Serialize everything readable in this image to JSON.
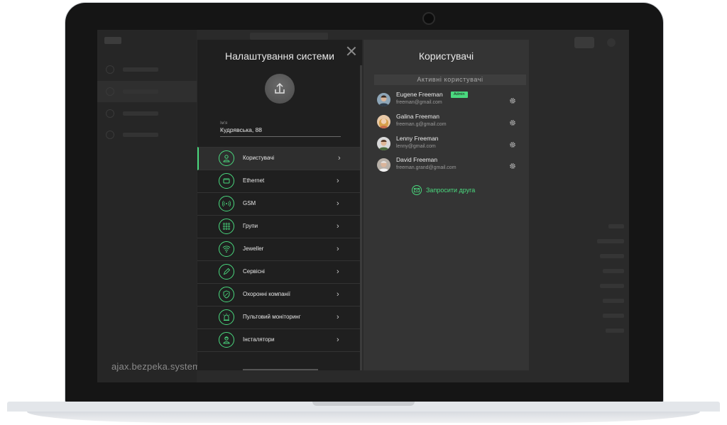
{
  "watermark": "ajax.bezpeka.systems",
  "settings": {
    "title": "Налаштування системи",
    "field_label": "Ім'я",
    "field_value": "Кудрявська, 88",
    "menu": [
      {
        "label": "Користувачі",
        "icon": "user-icon",
        "active": true
      },
      {
        "label": "Ethernet",
        "icon": "ethernet-icon",
        "active": false
      },
      {
        "label": "GSM",
        "icon": "antenna-icon",
        "active": false
      },
      {
        "label": "Групи",
        "icon": "grid-icon",
        "active": false
      },
      {
        "label": "Jeweller",
        "icon": "wifi-icon",
        "active": false
      },
      {
        "label": "Сервісні",
        "icon": "pencil-icon",
        "active": false
      },
      {
        "label": "Охоронні компанії",
        "icon": "shield-icon",
        "active": false
      },
      {
        "label": "Пультовий моніторинг",
        "icon": "siren-icon",
        "active": false
      },
      {
        "label": "Інсталятори",
        "icon": "installer-icon",
        "active": false
      }
    ],
    "chevron": "›"
  },
  "users": {
    "title": "Користувачі",
    "section_label": "Активні користувачі",
    "list": [
      {
        "name": "Eugene Freeman",
        "email": "freeman@gmail.com",
        "badge": "Admin"
      },
      {
        "name": "Galina Freeman",
        "email": "freeman.g@gmail.com"
      },
      {
        "name": "Lenny Freeman",
        "email": "lenny@gmail.com"
      },
      {
        "name": "David Freeman",
        "email": "freeman.grand@gmail.com"
      }
    ],
    "invite_label": "Запросити друга"
  },
  "colors": {
    "accent": "#4ad97e",
    "panel_dark": "#1f1f1f",
    "panel_mid": "#343434"
  }
}
